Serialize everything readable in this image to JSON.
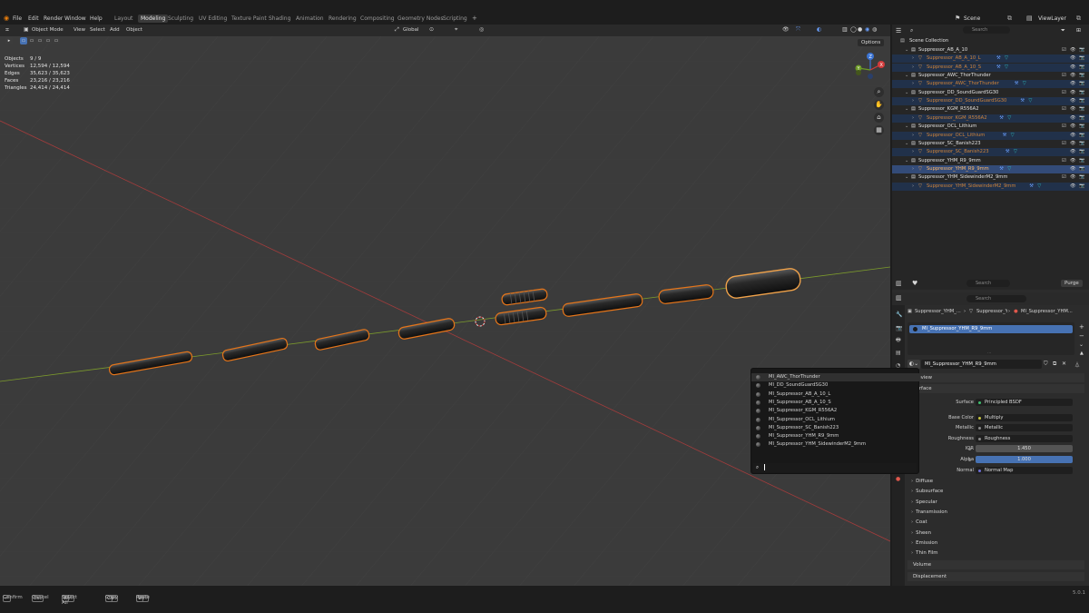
{
  "menu": {
    "items": [
      "File",
      "Edit",
      "Render",
      "Window",
      "Help"
    ],
    "workspaces": [
      "Layout",
      "Modeling",
      "Sculpting",
      "UV Editing",
      "Texture Paint",
      "Shading",
      "Animation",
      "Rendering",
      "Compositing",
      "Geometry Nodes",
      "Scripting"
    ],
    "active_workspace": "Modeling",
    "add_tab": "+",
    "scene": "Scene",
    "view_layer": "ViewLayer"
  },
  "viewport_header": {
    "mode": "Object Mode",
    "menus": [
      "View",
      "Select",
      "Add",
      "Object"
    ],
    "orientation": "Global",
    "options": "Options"
  },
  "stats": [
    {
      "label": "Objects",
      "value": "9 / 9"
    },
    {
      "label": "Vertices",
      "value": "12,594 / 12,594"
    },
    {
      "label": "Edges",
      "value": "35,623 / 35,623"
    },
    {
      "label": "Faces",
      "value": "23,216 / 23,216"
    },
    {
      "label": "Triangles",
      "value": "24,414 / 24,414"
    }
  ],
  "gizmo": {
    "x": "X",
    "y": "Y",
    "z": "Z"
  },
  "outliner": {
    "search_placeholder": "Search",
    "root": "Scene Collection",
    "rows": [
      {
        "text": "Suppressor_AB_A_10",
        "kind": "parent",
        "state": ""
      },
      {
        "text": "Suppressor_AB_A_10_L",
        "kind": "child",
        "state": "sel"
      },
      {
        "text": "Suppressor_AB_A_10_S",
        "kind": "child",
        "state": "sel"
      },
      {
        "text": "Suppressor_AWC_ThorThunder",
        "kind": "parent",
        "state": ""
      },
      {
        "text": "Suppressor_AWC_ThorThunder",
        "kind": "child",
        "state": "sel"
      },
      {
        "text": "Suppressor_DD_SoundGuardSG30",
        "kind": "parent",
        "state": ""
      },
      {
        "text": "Suppressor_DD_SoundGuardSG30",
        "kind": "child",
        "state": "sel"
      },
      {
        "text": "Suppressor_KGM_R556A2",
        "kind": "parent",
        "state": ""
      },
      {
        "text": "Suppressor_KGM_R556A2",
        "kind": "child",
        "state": "sel"
      },
      {
        "text": "Suppressor_OCL_Lithium",
        "kind": "parent",
        "state": ""
      },
      {
        "text": "Suppressor_OCL_Lithium",
        "kind": "child",
        "state": "sel"
      },
      {
        "text": "Suppressor_SC_Banish223",
        "kind": "parent",
        "state": ""
      },
      {
        "text": "Suppressor_SC_Banish223",
        "kind": "child",
        "state": "sel"
      },
      {
        "text": "Suppressor_YHM_R9_9mm",
        "kind": "parent",
        "state": ""
      },
      {
        "text": "Suppressor_YHM_R9_9mm",
        "kind": "child",
        "state": "act"
      },
      {
        "text": "Suppressor_YHM_SidewinderM2_9mm",
        "kind": "parent",
        "state": ""
      },
      {
        "text": "Suppressor_YHM_SidewinderM2_9mm",
        "kind": "child",
        "state": "sel"
      }
    ]
  },
  "properties": {
    "search_placeholder": "Search",
    "purge": "Purge",
    "breadcrumb": [
      "Suppressor_YHM_...",
      "Suppressor_YHM...",
      "MI_Suppressor_YHM..."
    ],
    "slot": "MI_Suppressor_YHM_R9_9mm",
    "material_name": "MI_Suppressor_YHM_R9_9mm",
    "preview_header": "Preview",
    "surface_header": "Surface",
    "fields": [
      {
        "label": "Surface",
        "value": "Principled BSDF",
        "dot": "#3fbf6e",
        "type": "link"
      },
      {
        "label": "Base Color",
        "value": "Multiply",
        "dot": "#c9c640",
        "type": "link"
      },
      {
        "label": "Metallic",
        "value": "Metallic",
        "dot": "#8a8a8a",
        "type": "link"
      },
      {
        "label": "Roughness",
        "value": "Roughness",
        "dot": "#8a8a8a",
        "type": "link"
      },
      {
        "label": "IOR",
        "value": "1.450",
        "dot": "#8a8a8a",
        "type": "num"
      },
      {
        "label": "Alpha",
        "value": "1.000",
        "dot": "#8a8a8a",
        "type": "blue"
      },
      {
        "label": "Normal",
        "value": "Normal Map",
        "dot": "#6f6fd6",
        "type": "link"
      }
    ],
    "subpanels": [
      "Diffuse",
      "Subsurface",
      "Specular",
      "Transmission",
      "Coat",
      "Sheen",
      "Emission",
      "Thin Film"
    ],
    "volume": "Volume",
    "displacement": "Displacement"
  },
  "dropdown": {
    "items": [
      "MI_AWC_ThorThunder",
      "MI_DD_SoundGuardSG30",
      "MI_Suppressor_AB_A_10_L",
      "MI_Suppressor_AB_A_10_S",
      "MI_Suppressor_KGM_R556A2",
      "MI_Suppressor_OCL_Lithium",
      "MI_Suppressor_SC_Banish223",
      "MI_Suppressor_YHM_R9_9mm",
      "MI_Suppressor_YHM_SidewinderM2_9mm"
    ],
    "search_value": ""
  },
  "statusbar": {
    "items": [
      {
        "key": "↵",
        "label": "Confirm"
      },
      {
        "key": "Esc",
        "label": "Cancel"
      },
      {
        "key": "Ctrl",
        "key2": "A",
        "label": "Select All"
      },
      {
        "key": "Ctrl",
        "key2": "C",
        "label": "Copy"
      },
      {
        "key": "Ctrl",
        "key2": "V",
        "label": "Paste"
      }
    ],
    "version": "5.0.1"
  }
}
